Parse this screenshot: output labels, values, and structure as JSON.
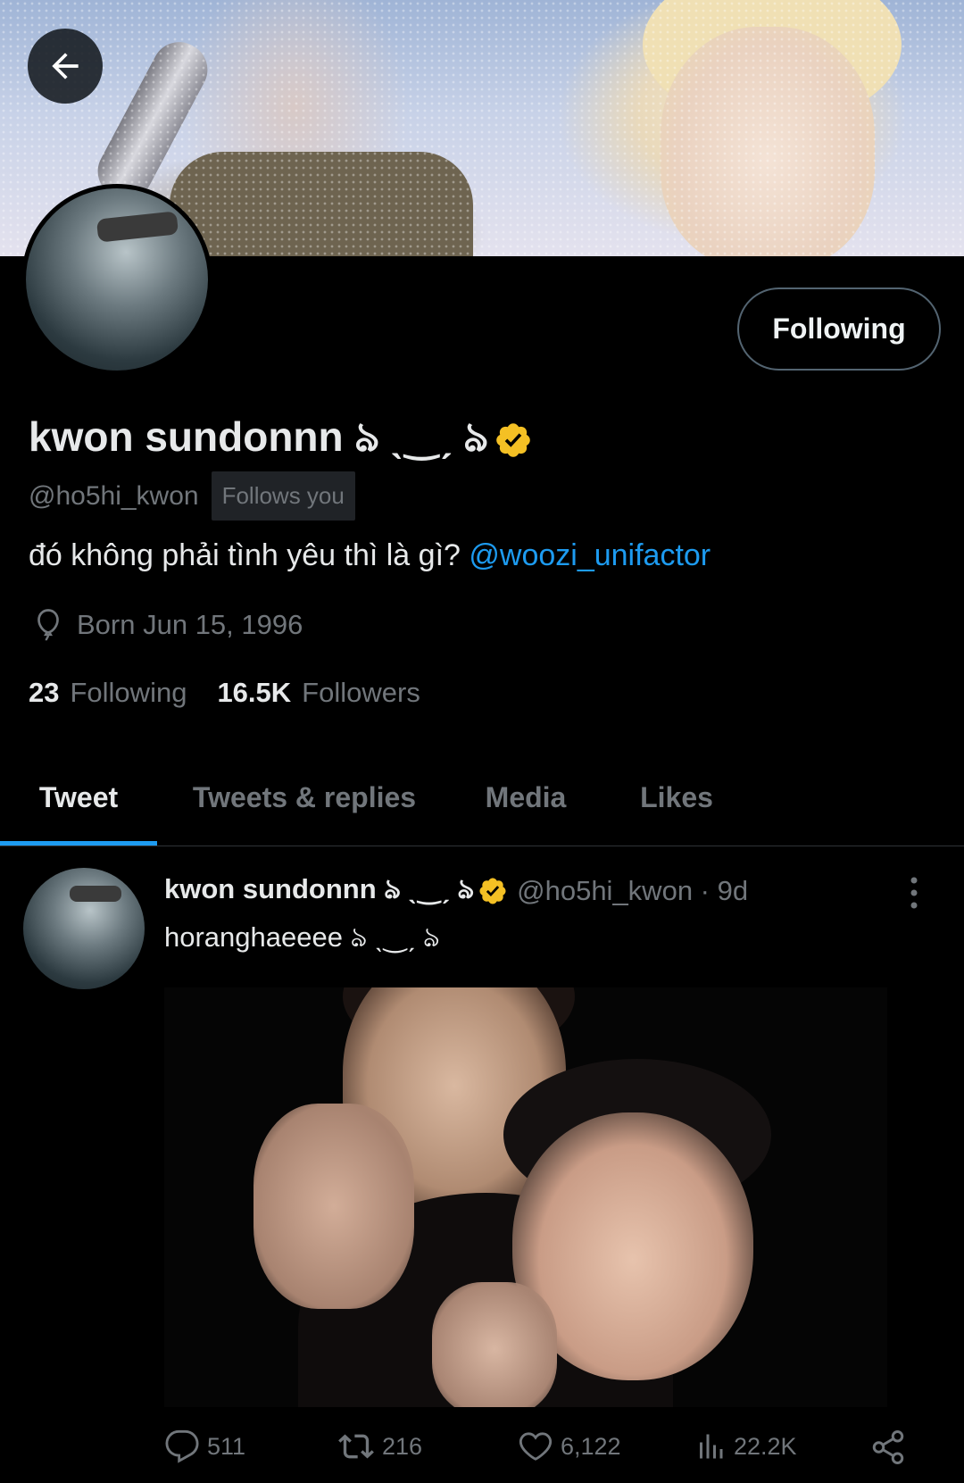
{
  "header": {
    "back_icon": "arrow-left-icon"
  },
  "profile": {
    "display_name": "kwon sundonnn ঌ ˎ‿ˏ ঌ",
    "verified_icon": "verified-badge-icon",
    "verified_color": "#f4c024",
    "handle": "@ho5hi_kwon",
    "follows_you": "Follows you",
    "follow_button": "Following",
    "bio_text": "đó không phải tình yêu thì là gì? ",
    "bio_mention": "@woozi_unifactor",
    "born": "Born Jun 15, 1996",
    "born_icon": "balloon-icon",
    "following_count": "23",
    "following_label": "Following",
    "followers_count": "16.5K",
    "followers_label": "Followers"
  },
  "tabs": [
    {
      "label": "Tweet",
      "active": true
    },
    {
      "label": "Tweets & replies",
      "active": false
    },
    {
      "label": "Media",
      "active": false
    },
    {
      "label": "Likes",
      "active": false
    }
  ],
  "tweet": {
    "name": "kwon sundonnn ঌ ˎ‿ˏ ঌ",
    "handle_time": "@ho5hi_kwon · 9d",
    "text": "horanghaeeee ঌ ˎ‿ˏ ঌ",
    "more_icon": "more-vertical-icon",
    "replies": "511",
    "retweets": "216",
    "likes": "6,122",
    "views": "22.2K"
  },
  "colors": {
    "accent": "#1d9bf0",
    "muted": "#71767b",
    "text": "#e7e9ea",
    "background": "#000000"
  }
}
